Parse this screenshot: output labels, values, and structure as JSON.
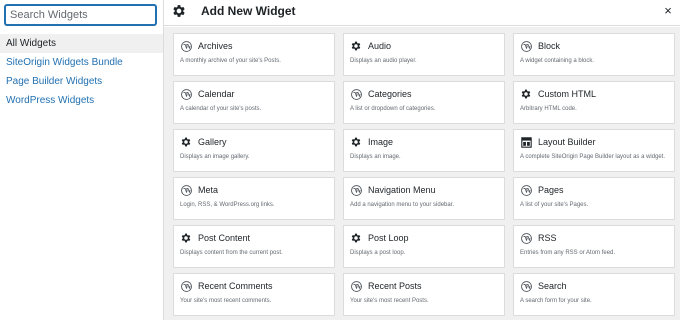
{
  "search": {
    "placeholder": "Search Widgets",
    "value": ""
  },
  "categories": [
    {
      "label": "All Widgets",
      "active": true
    },
    {
      "label": "SiteOrigin Widgets Bundle",
      "active": false
    },
    {
      "label": "Page Builder Widgets",
      "active": false
    },
    {
      "label": "WordPress Widgets",
      "active": false
    }
  ],
  "header": {
    "title": "Add New Widget",
    "close_label": "×"
  },
  "widgets": [
    {
      "title": "Archives",
      "description": "A monthly archive of your site's Posts.",
      "icon": "wordpress-icon"
    },
    {
      "title": "Audio",
      "description": "Displays an audio player.",
      "icon": "gear-icon"
    },
    {
      "title": "Block",
      "description": "A widget containing a block.",
      "icon": "wordpress-icon"
    },
    {
      "title": "Calendar",
      "description": "A calendar of your site's posts.",
      "icon": "wordpress-icon"
    },
    {
      "title": "Categories",
      "description": "A list or dropdown of categories.",
      "icon": "wordpress-icon"
    },
    {
      "title": "Custom HTML",
      "description": "Arbitrary HTML code.",
      "icon": "gear-icon"
    },
    {
      "title": "Gallery",
      "description": "Displays an image gallery.",
      "icon": "gear-icon"
    },
    {
      "title": "Image",
      "description": "Displays an image.",
      "icon": "gear-icon"
    },
    {
      "title": "Layout Builder",
      "description": "A complete SiteOrigin Page Builder layout as a widget.",
      "icon": "layout-icon"
    },
    {
      "title": "Meta",
      "description": "Login, RSS, & WordPress.org links.",
      "icon": "wordpress-icon"
    },
    {
      "title": "Navigation Menu",
      "description": "Add a navigation menu to your sidebar.",
      "icon": "wordpress-icon"
    },
    {
      "title": "Pages",
      "description": "A list of your site's Pages.",
      "icon": "wordpress-icon"
    },
    {
      "title": "Post Content",
      "description": "Displays content from the current post.",
      "icon": "gear-icon"
    },
    {
      "title": "Post Loop",
      "description": "Displays a post loop.",
      "icon": "gear-icon"
    },
    {
      "title": "RSS",
      "description": "Entries from any RSS or Atom feed.",
      "icon": "wordpress-icon"
    },
    {
      "title": "Recent Comments",
      "description": "Your site's most recent comments.",
      "icon": "wordpress-icon"
    },
    {
      "title": "Recent Posts",
      "description": "Your site's most recent Posts.",
      "icon": "wordpress-icon"
    },
    {
      "title": "Search",
      "description": "A search form for your site.",
      "icon": "wordpress-icon"
    }
  ]
}
